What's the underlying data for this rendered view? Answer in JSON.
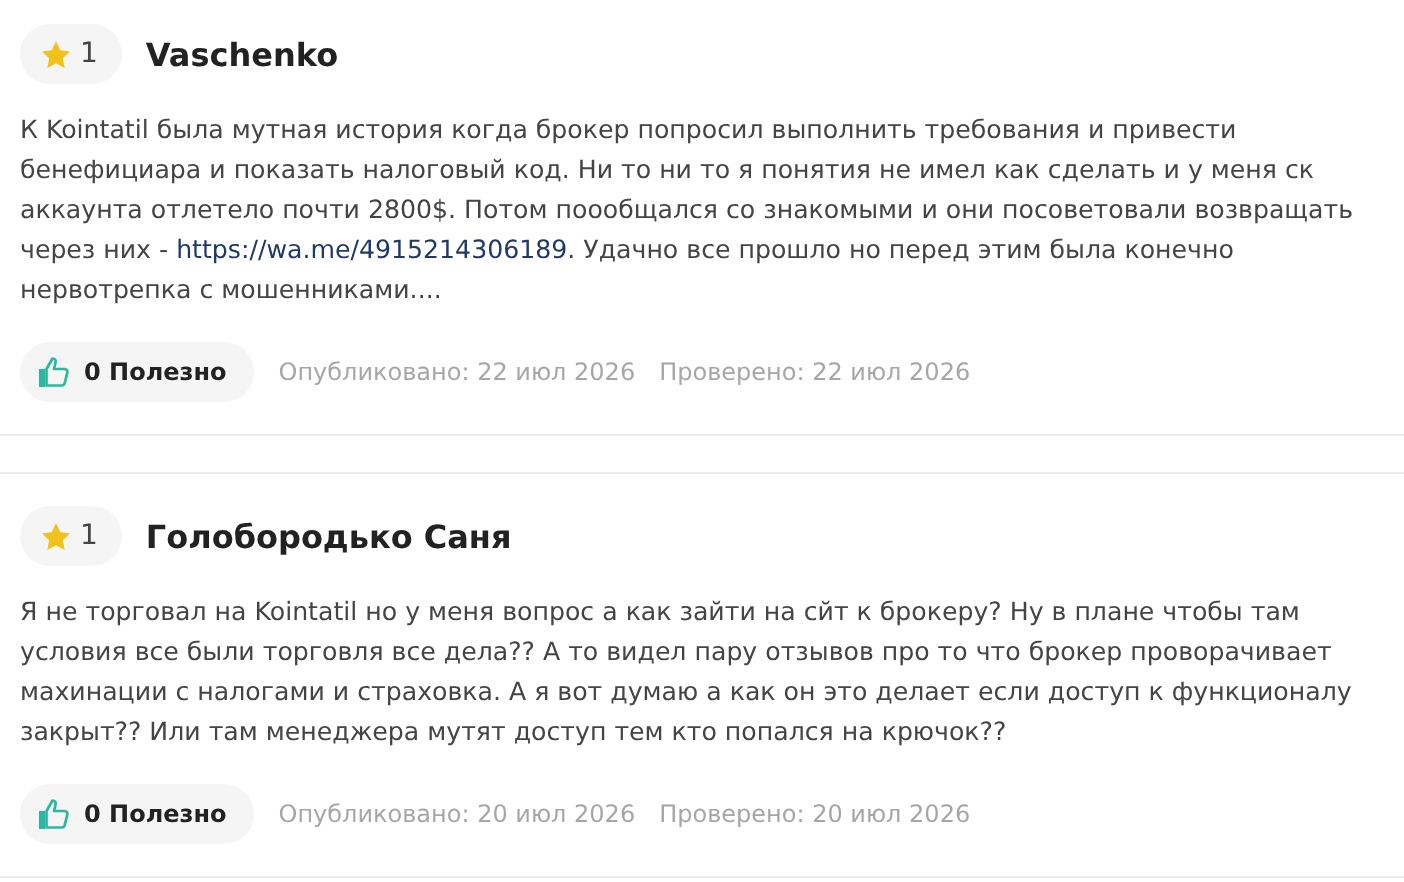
{
  "reviews": [
    {
      "rating": "1",
      "author": "Vaschenko",
      "body": [
        {
          "kind": "text",
          "text": "К Kointatil была мутная история когда брокер попросил выполнить требования и привести бенефициара и показать налоговый код. Ни то ни то я понятия не имел как сделать и у меня ск аккаунта отлетело почти 2800$. Потом поообщался со знакомыми и они посоветовали возвращать через них - "
        },
        {
          "kind": "link",
          "text": "https://wa.me/4915214306189"
        },
        {
          "kind": "text",
          "text": ". Удачно все прошло но перед этим была конечно нервотрепка с мошенниками...."
        }
      ],
      "helpful": "0 Полезно",
      "published": "Опубликовано: 22 июл 2026",
      "verified": "Проверено: 22 июл 2026"
    },
    {
      "rating": "1",
      "author": "Голобородько Саня",
      "body": [
        {
          "kind": "text",
          "text": "Я не торговал на Kointatil но у меня вопрос а как зайти на сйт к брокеру? Ну в плане чтобы там условия все были торговля все дела?? А то видел пару отзывов про то что брокер проворачивает махинации с налогами и страховка. А я вот думаю а как он это делает если доступ к функционалу закрыт?? Или там менеджера мутят доступ тем кто попался на крючок??"
        }
      ],
      "helpful": "0 Полезно",
      "published": "Опубликовано: 20 июл 2026",
      "verified": "Проверено: 20 июл 2026"
    }
  ]
}
